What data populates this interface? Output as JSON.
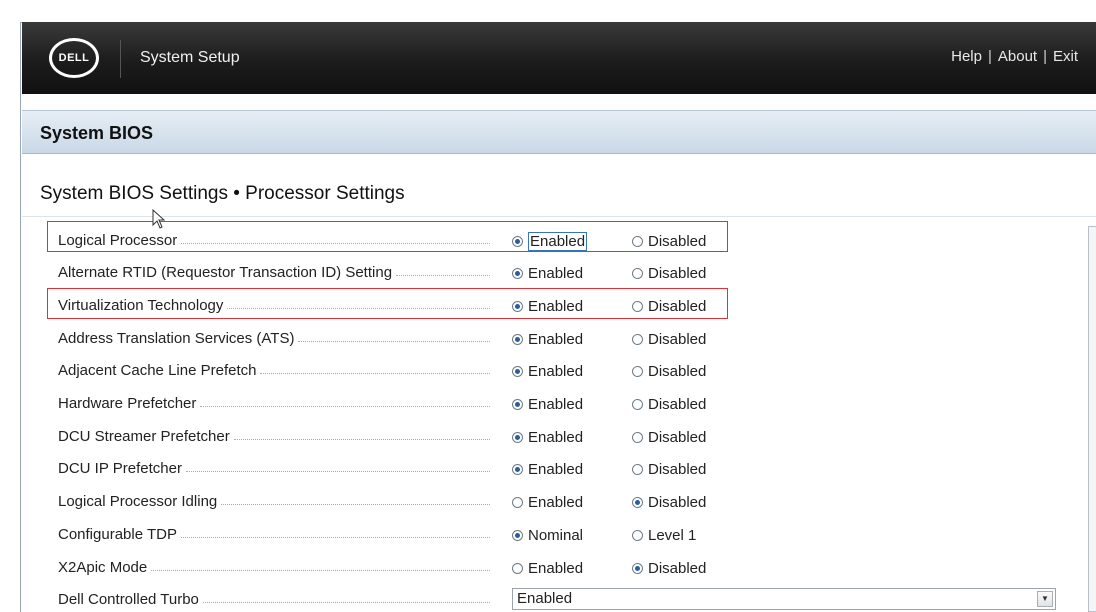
{
  "topbar": {
    "logo_text": "DELL",
    "title": "System Setup",
    "links": [
      "Help",
      "About",
      "Exit"
    ],
    "separator": "|"
  },
  "section": {
    "title": "System BIOS"
  },
  "page": {
    "subtitle": "System BIOS Settings • Processor Settings"
  },
  "settings": [
    {
      "label": "Logical Processor",
      "option1": "Enabled",
      "option2": "Disabled",
      "selected": 1
    },
    {
      "label": "Alternate RTID (Requestor Transaction ID) Setting",
      "option1": "Enabled",
      "option2": "Disabled",
      "selected": 1
    },
    {
      "label": "Virtualization Technology",
      "option1": "Enabled",
      "option2": "Disabled",
      "selected": 1
    },
    {
      "label": "Address Translation Services (ATS)",
      "option1": "Enabled",
      "option2": "Disabled",
      "selected": 1
    },
    {
      "label": "Adjacent Cache Line Prefetch",
      "option1": "Enabled",
      "option2": "Disabled",
      "selected": 1
    },
    {
      "label": "Hardware Prefetcher",
      "option1": "Enabled",
      "option2": "Disabled",
      "selected": 1
    },
    {
      "label": "DCU Streamer Prefetcher",
      "option1": "Enabled",
      "option2": "Disabled",
      "selected": 1
    },
    {
      "label": "DCU IP Prefetcher",
      "option1": "Enabled",
      "option2": "Disabled",
      "selected": 1
    },
    {
      "label": "Logical Processor Idling",
      "option1": "Enabled",
      "option2": "Disabled",
      "selected": 2
    },
    {
      "label": "Configurable TDP",
      "option1": "Nominal",
      "option2": "Level 1",
      "selected": 1
    },
    {
      "label": "X2Apic Mode",
      "option1": "Enabled",
      "option2": "Disabled",
      "selected": 2
    }
  ],
  "turbo": {
    "label": "Dell Controlled Turbo",
    "value": "Enabled"
  },
  "colors": {
    "highlight": "#e0303a",
    "radio_selected": "#2b5c9e",
    "header_bar": "#1c1c1c"
  }
}
